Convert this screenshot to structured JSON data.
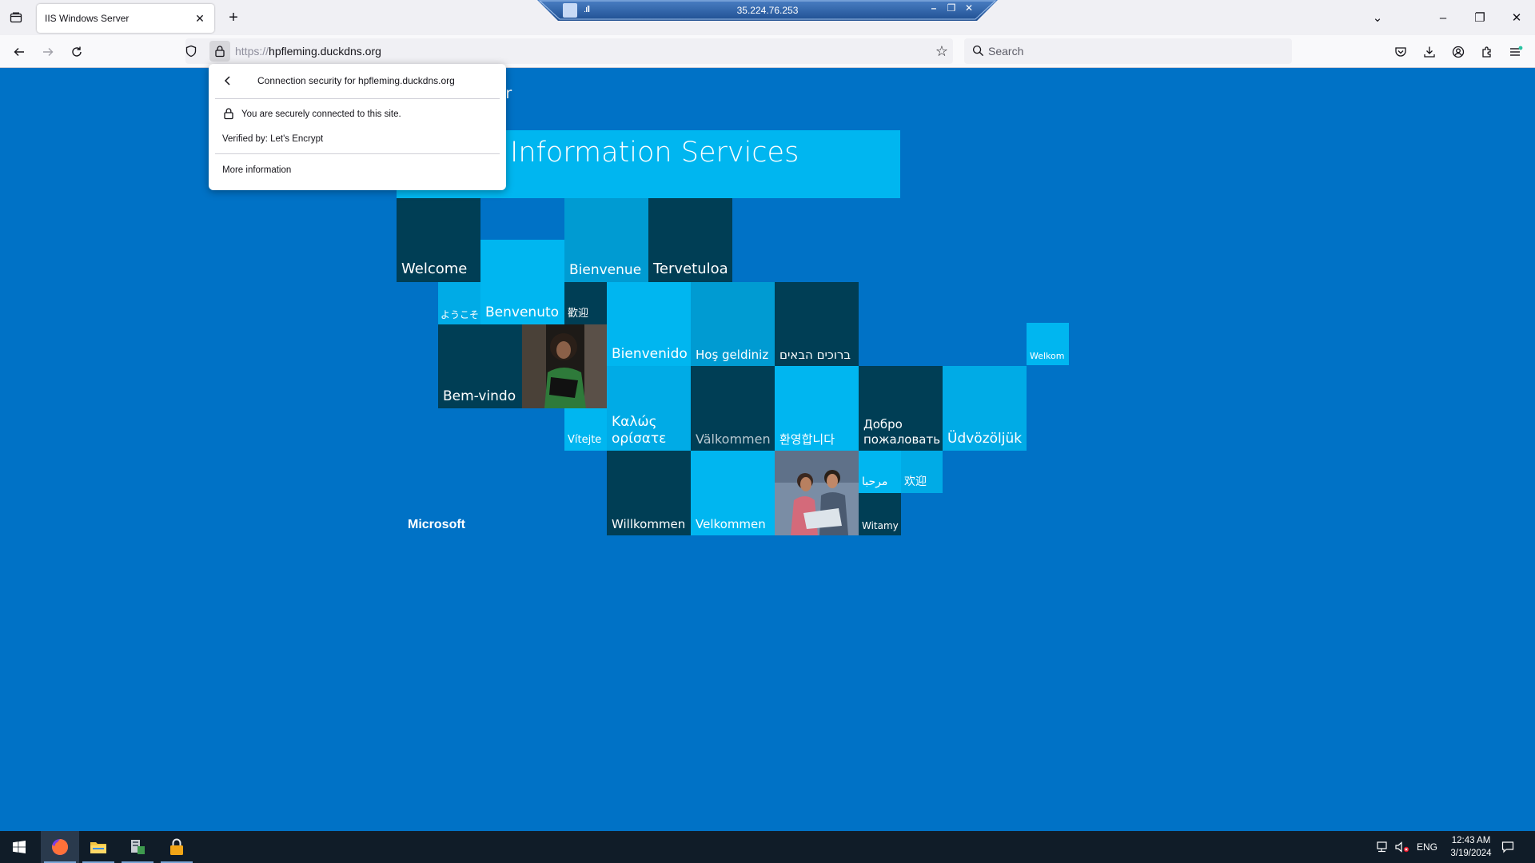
{
  "browser": {
    "tab_title": "IIS Windows Server",
    "url_scheme": "https://",
    "url_host": "hpfleming.duckdns.org",
    "search_placeholder": "Search"
  },
  "rdp": {
    "ip": "35.224.76.253"
  },
  "popup": {
    "header": "Connection security for hpfleming.duckdns.org",
    "secure_text": "You are securely connected to this site.",
    "verified_text": "Verified by: Let's Encrypt",
    "more_info": "More information"
  },
  "page": {
    "title_fragment": "erver",
    "banner": "Information Services",
    "brand": "Microsoft",
    "tiles": {
      "welcome": "Welcome",
      "bienvenue": "Bienvenue",
      "tervetuloa": "Tervetuloa",
      "youkoso": "ようこそ",
      "benvenuto": "Benvenuto",
      "huanying_trad": "歡迎",
      "bienvenido": "Bienvenido",
      "hos_geldiniz": "Hoş geldiniz",
      "hebrew": "ברוכים הבאים",
      "welkom": "Welkom",
      "bem_vindo": "Bem-vindo",
      "vitejte": "Vítejte",
      "kalos": "Καλώς ορίσατε",
      "valkommen": "Välkommen",
      "korean": "환영합니다",
      "dobro_line1": "Добро",
      "dobro_line2": "пожаловать",
      "udvozoljuk": "Üdvözöljük",
      "arabic": "مرحبا",
      "huanying_simp": "欢迎",
      "willkommen": "Willkommen",
      "velkommen": "Velkommen",
      "witamy": "Witamy"
    }
  },
  "taskbar": {
    "lang": "ENG",
    "time": "12:43 AM",
    "date": "3/19/2024"
  },
  "colors": {
    "page_bg": "#0072c6",
    "tile_dark": "#003e55",
    "tile_light": "#00b6f0",
    "tile_mid": "#009bd2",
    "taskbar": "#101c28"
  }
}
